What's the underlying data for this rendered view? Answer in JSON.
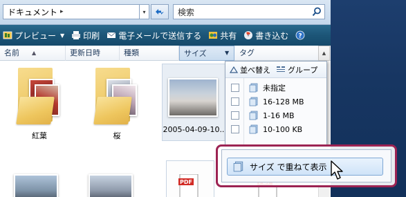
{
  "address": {
    "path": "ドキュメント",
    "sep": "▸",
    "dropdown": "▾"
  },
  "search": {
    "placeholder": "検索",
    "icon": "search-icon"
  },
  "toolbar": {
    "preview": "プレビュー",
    "print": "印刷",
    "email": "電子メールで送信する",
    "share": "共有",
    "burn": "書き込む"
  },
  "columns": {
    "name": "名前",
    "modified": "更新日時",
    "type": "種類",
    "size": "サイズ",
    "tags": "タグ"
  },
  "files": [
    {
      "label": "紅葉",
      "kind": "folder"
    },
    {
      "label": "桜",
      "kind": "folder"
    },
    {
      "label": "2005-04-09-10..",
      "kind": "photo"
    }
  ],
  "menu": {
    "sort": "並べ替え",
    "group": "グループ",
    "items": [
      {
        "label": "未指定"
      },
      {
        "label": "16-128 MB"
      },
      {
        "label": "1-16 MB"
      },
      {
        "label": "10-100 KB"
      }
    ],
    "stack": "サイズ で重ねて表示"
  },
  "colors": {
    "callout": "#9c2353",
    "toolbar": "#1c5577",
    "chrome": "#173662"
  }
}
